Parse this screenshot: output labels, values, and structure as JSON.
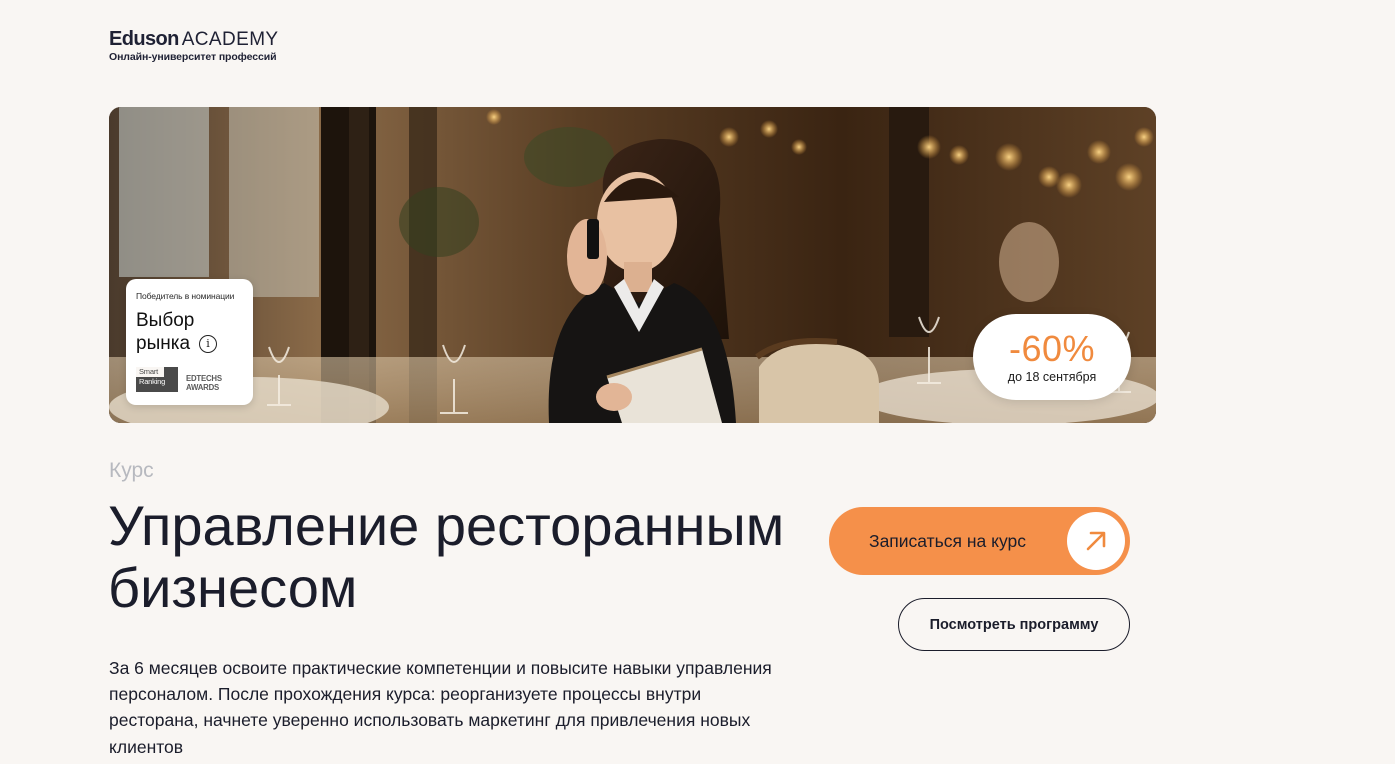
{
  "header": {
    "logo_brand": "Eduson",
    "logo_suffix": "ACADEMY",
    "tagline": "Онлайн-университет профессий"
  },
  "hero": {
    "award": {
      "caption": "Победитель в номинации",
      "title_line1": "Выбор",
      "title_line2": "рынка",
      "info_icon": "info-icon",
      "logo1_top": "Smart",
      "logo1_bottom": "Ranking",
      "logo2_top": "EDTECHS",
      "logo2_bottom": "AWARDS"
    },
    "discount": {
      "value": "-60%",
      "until": "до 18 сентября"
    }
  },
  "course": {
    "label": "Курс",
    "title": "Управление ресторанным бизнесом",
    "description": "За 6 месяцев освоите практические компетенции и повысите навыки управления персоналом. После прохождения курса: реорганизуете процессы внутри ресторана, начнете уверенно использовать маркетинг для привлечения новых клиентов"
  },
  "actions": {
    "enroll_label": "Записаться на курс",
    "enroll_icon": "arrow-up-right-icon",
    "program_label": "Посмотреть программу"
  },
  "colors": {
    "background": "#f9f6f3",
    "accent": "#f5904a",
    "discount_text": "#f08a3e",
    "text": "#1b1d2b",
    "muted": "#b7b9bf"
  }
}
